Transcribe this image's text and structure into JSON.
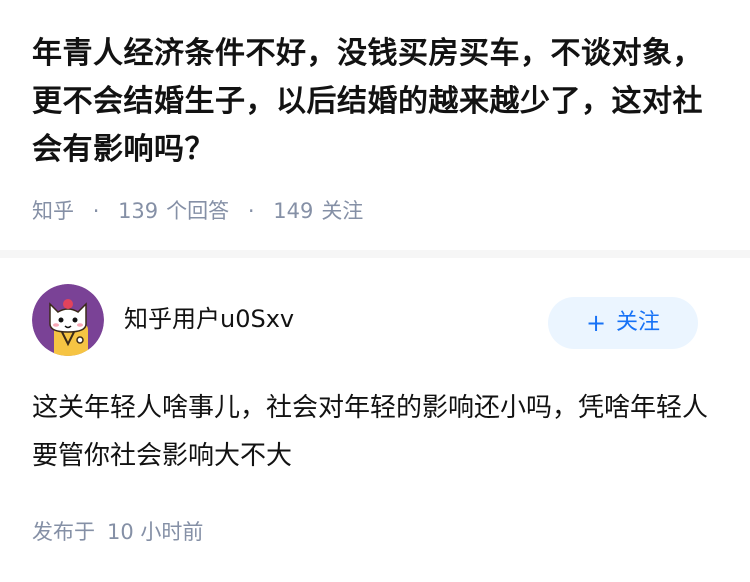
{
  "question": {
    "title": "年青人经济条件不好，没钱买房买车，不谈对象，更不会结婚生子，以后结婚的越来越少了，这对社会有影响吗？",
    "source": "知乎",
    "separator": "·",
    "answer_count": "139",
    "answer_label": "个回答",
    "follower_count": "149",
    "follower_label": "关注"
  },
  "answer": {
    "author": {
      "name": "知乎用户u0Sxv",
      "avatar_icon": "cartoon-cat-avatar-icon"
    },
    "follow_button": {
      "plus": "+",
      "label": "关注"
    },
    "content": "这关年轻人啥事儿，社会对年轻的影响还小吗，凭啥年轻人要管你社会影响大不大",
    "time_prefix": "发布于",
    "time": "10 小时前"
  },
  "colors": {
    "title": "#121212",
    "meta": "#8590a6",
    "accent": "#1772f6",
    "button_bg": "#ebf5ff",
    "divider": "#f6f6f6",
    "avatar_bg": "#7a4296"
  }
}
